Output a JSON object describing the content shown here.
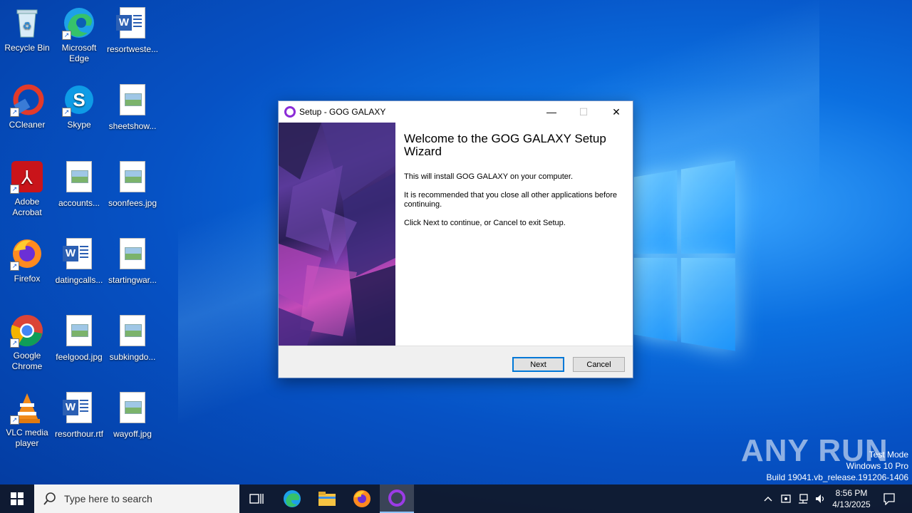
{
  "desktop": {
    "icons": [
      {
        "label": "Recycle Bin",
        "icon": "recycle-bin-icon"
      },
      {
        "label": "Microsoft Edge",
        "icon": "edge-icon"
      },
      {
        "label": "resortweste...",
        "icon": "word-doc-icon"
      },
      {
        "label": "CCleaner",
        "icon": "ccleaner-icon"
      },
      {
        "label": "Skype",
        "icon": "skype-icon"
      },
      {
        "label": "sheetshow...",
        "icon": "image-file-icon"
      },
      {
        "label": "Adobe Acrobat",
        "icon": "acrobat-icon"
      },
      {
        "label": "accounts...",
        "icon": "image-file-icon"
      },
      {
        "label": "soonfees.jpg",
        "icon": "image-file-icon"
      },
      {
        "label": "Firefox",
        "icon": "firefox-icon"
      },
      {
        "label": "datingcalls...",
        "icon": "word-doc-icon"
      },
      {
        "label": "startingwar...",
        "icon": "image-file-icon"
      },
      {
        "label": "Google Chrome",
        "icon": "chrome-icon"
      },
      {
        "label": "feelgood.jpg",
        "icon": "image-file-icon"
      },
      {
        "label": "subkingdo...",
        "icon": "image-file-icon"
      },
      {
        "label": "VLC media player",
        "icon": "vlc-icon"
      },
      {
        "label": "resorthour.rtf",
        "icon": "word-doc-icon"
      },
      {
        "label": "wayoff.jpg",
        "icon": "image-file-icon"
      }
    ]
  },
  "window": {
    "title": "Setup - GOG GALAXY",
    "heading": "Welcome to the GOG GALAXY Setup Wizard",
    "paragraphs": [
      "This will install GOG GALAXY on your computer.",
      "It is recommended that you close all other applications before continuing.",
      "Click Next to continue, or Cancel to exit Setup."
    ],
    "next_label": "Next",
    "cancel_label": "Cancel",
    "minimize_glyph": "—",
    "maximize_glyph": "☐",
    "close_glyph": "✕"
  },
  "taskbar": {
    "search_placeholder": "Type here to search",
    "time": "8:56 PM",
    "date": "4/13/2025"
  },
  "watermark": {
    "line1": "Test Mode",
    "line2": "Windows 10 Pro",
    "line3": "Build 19041.vb_release.191206-1406",
    "brand": "ANY RUN"
  },
  "colors": {
    "accent": "#0078d7",
    "gog_purple": "#8b2bd6",
    "taskbar": "#101828"
  }
}
